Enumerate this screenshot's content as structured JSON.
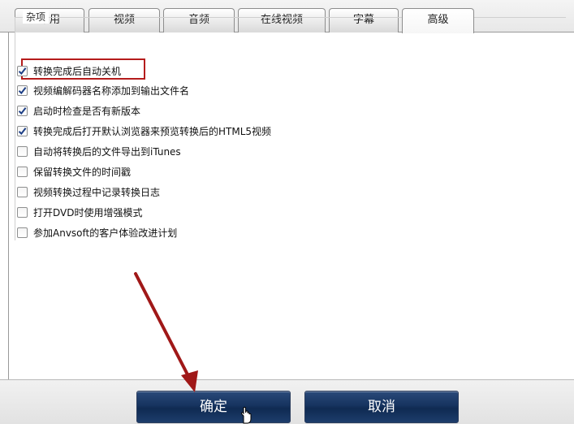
{
  "tabs": [
    {
      "label": "常用",
      "active": false
    },
    {
      "label": "视频",
      "active": false
    },
    {
      "label": "音频",
      "active": false
    },
    {
      "label": "在线视频",
      "active": false
    },
    {
      "label": "字幕",
      "active": false
    },
    {
      "label": "高级",
      "active": true
    }
  ],
  "group": {
    "legend": "杂项",
    "options": [
      {
        "label": "转换完成后自动关机",
        "checked": true
      },
      {
        "label": "视频编解码器名称添加到输出文件名",
        "checked": true
      },
      {
        "label": "启动时检查是否有新版本",
        "checked": true
      },
      {
        "label": "转换完成后打开默认浏览器来预览转换后的HTML5视频",
        "checked": true
      },
      {
        "label": "自动将转换后的文件导出到iTunes",
        "checked": false
      },
      {
        "label": "保留转换文件的时间戳",
        "checked": false
      },
      {
        "label": "视频转换过程中记录转换日志",
        "checked": false
      },
      {
        "label": "打开DVD时使用增强模式",
        "checked": false
      },
      {
        "label": "参加Anvsoft的客户体验改进计划",
        "checked": false
      }
    ]
  },
  "footer": {
    "ok_label": "确定",
    "cancel_label": "取消"
  },
  "colors": {
    "highlight_box": "#b51c1c",
    "arrow": "#a01818",
    "button": "#16335f"
  },
  "icons": [
    "checkmark-icon",
    "annotation-arrow-icon",
    "hand-cursor-icon"
  ]
}
